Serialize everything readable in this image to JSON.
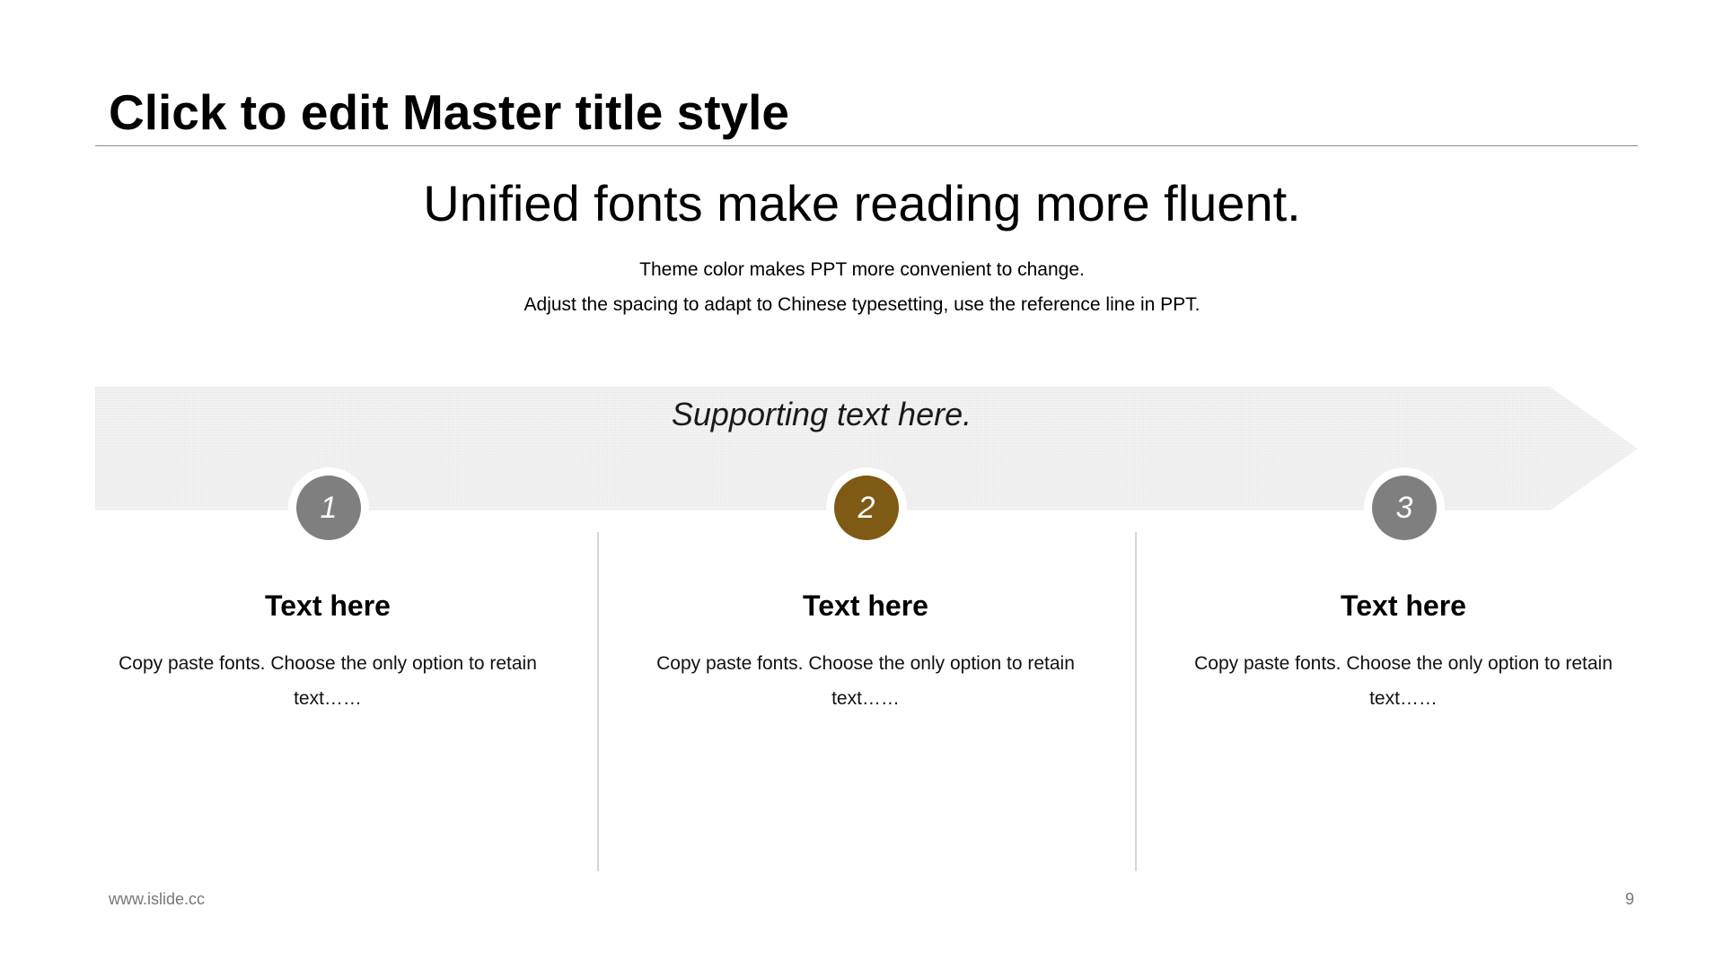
{
  "slide": {
    "title": "Click to edit Master title style",
    "headline": "Unified fonts make reading more fluent.",
    "sublines": [
      "Theme color makes PPT more convenient  to change.",
      "Adjust  the  spacing  to adapt to Chinese  typesetting,  use  the  reference line  in PPT."
    ],
    "supporting_text": "Supporting text here."
  },
  "steps": [
    {
      "number": "1",
      "heading": "Text here",
      "body": "Copy paste fonts. Choose the only  option to retain text……",
      "color": "#7f7f7f"
    },
    {
      "number": "2",
      "heading": "Text here",
      "body": "Copy paste fonts. Choose the only  option to retain text……",
      "color": "#7f5a14"
    },
    {
      "number": "3",
      "heading": "Text here",
      "body": "Copy paste fonts. Choose the only  option to retain text……",
      "color": "#7f7f7f"
    }
  ],
  "footer": {
    "url": "www.islide.cc",
    "page_number": "9"
  },
  "colors": {
    "accent": "#7f5a14",
    "neutral": "#7f7f7f",
    "band": "#efefef",
    "divider": "#d6d6d6"
  }
}
